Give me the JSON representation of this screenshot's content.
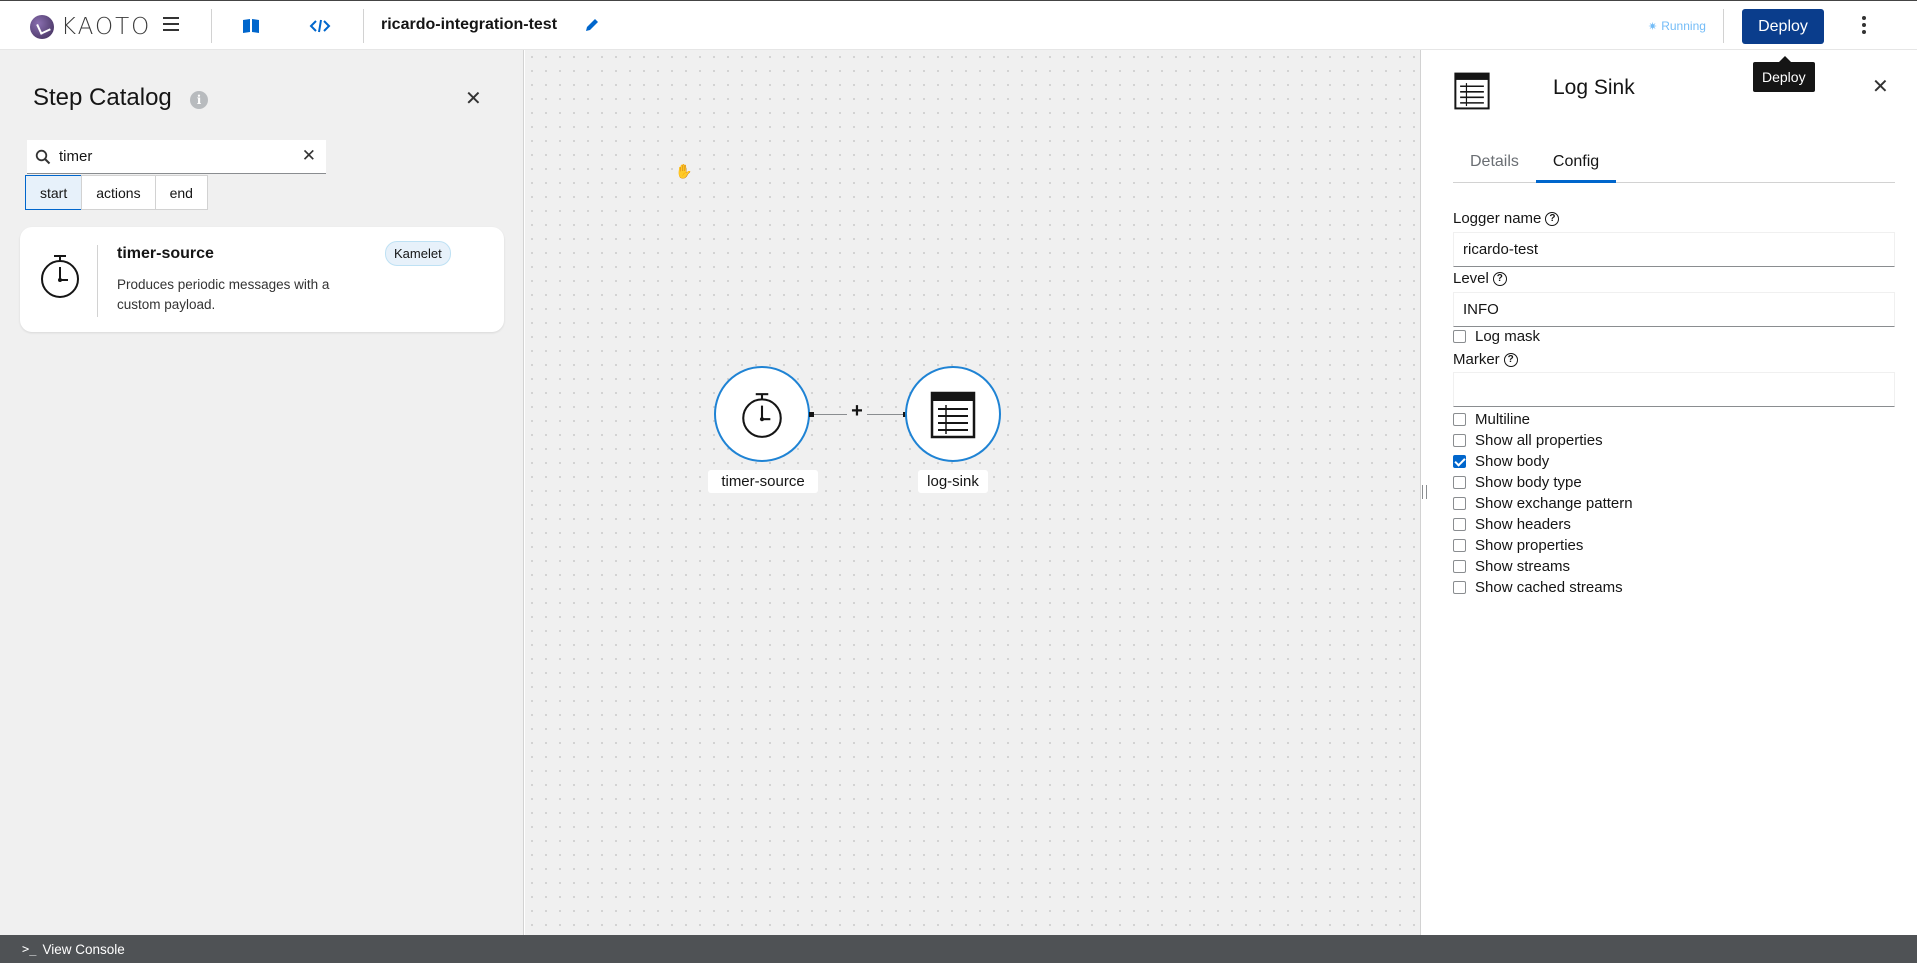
{
  "header": {
    "logo_text": "KAOTO",
    "integration_name": "ricardo-integration-test",
    "status": "Running",
    "deploy_label": "Deploy",
    "tooltip": "Deploy"
  },
  "catalog": {
    "title": "Step Catalog",
    "search": {
      "value": "timer"
    },
    "filters": [
      {
        "label": "start",
        "active": true
      },
      {
        "label": "actions",
        "active": false
      },
      {
        "label": "end",
        "active": false
      }
    ],
    "results": [
      {
        "name": "timer-source",
        "description": "Produces periodic messages with a custom payload.",
        "badge": "Kamelet",
        "icon": "stopwatch-icon"
      }
    ]
  },
  "canvas": {
    "nodes": [
      {
        "label": "timer-source",
        "icon": "stopwatch-icon"
      },
      {
        "label": "log-sink",
        "icon": "table-icon"
      }
    ],
    "add_step": "+"
  },
  "panel": {
    "title": "Log Sink",
    "icon": "table-icon",
    "tabs": [
      {
        "label": "Details",
        "active": false
      },
      {
        "label": "Config",
        "active": true
      }
    ],
    "fields": {
      "logger_name": {
        "label": "Logger name",
        "value": "ricardo-test"
      },
      "level": {
        "label": "Level",
        "value": "INFO"
      },
      "marker": {
        "label": "Marker",
        "value": ""
      }
    },
    "log_mask": {
      "label": "Log mask",
      "checked": false
    },
    "options": [
      {
        "label": "Multiline",
        "checked": false
      },
      {
        "label": "Show all properties",
        "checked": false
      },
      {
        "label": "Show body",
        "checked": true
      },
      {
        "label": "Show body type",
        "checked": false
      },
      {
        "label": "Show exchange pattern",
        "checked": false
      },
      {
        "label": "Show headers",
        "checked": false
      },
      {
        "label": "Show properties",
        "checked": false
      },
      {
        "label": "Show streams",
        "checked": false
      },
      {
        "label": "Show cached streams",
        "checked": false
      }
    ]
  },
  "footer": {
    "console_label": "View Console"
  },
  "colors": {
    "accent": "#0066cc",
    "deploy": "#0a3d8c",
    "node_border": "#1f83d4",
    "status": "#73bcf7"
  }
}
